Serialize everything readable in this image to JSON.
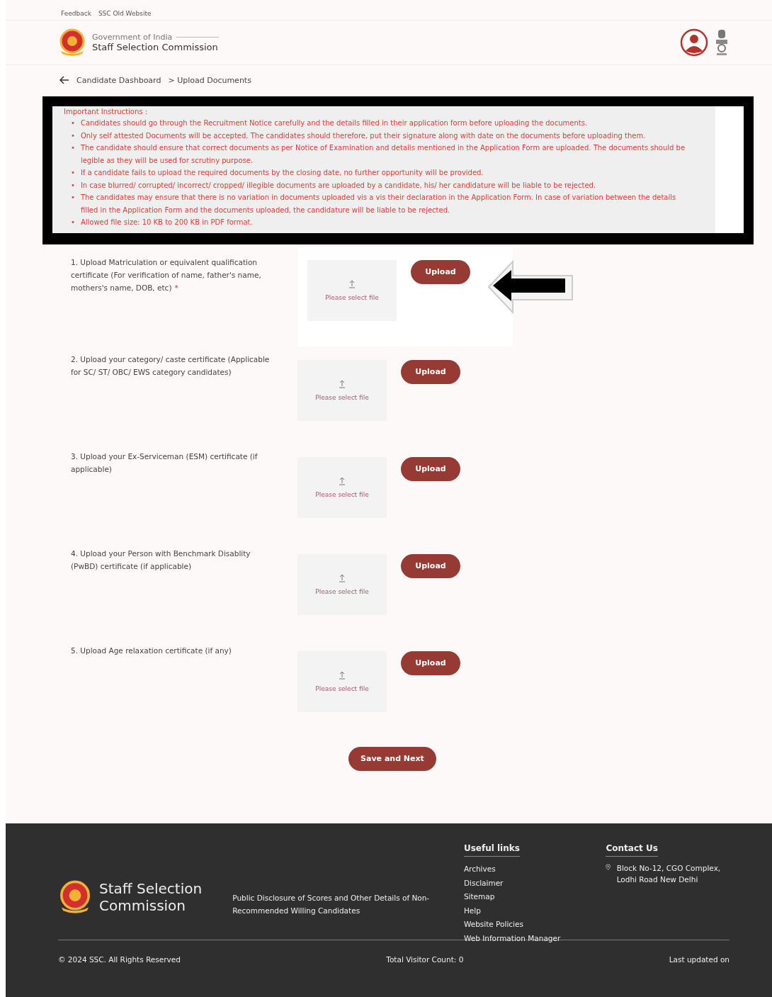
{
  "top_links": [
    "Feedback",
    "SSC Old Website"
  ],
  "header": {
    "org_line": "Government of India",
    "title": "Staff Selection Commission"
  },
  "breadcrumb": [
    {
      "label": "Candidate Dashboard"
    },
    {
      "label": "> Upload Documents"
    }
  ],
  "instructions": {
    "heading": "Important Instructions :",
    "bullet": "•",
    "items": [
      "Candidates should go through the Recruitment Notice carefully and the details filled in their application form before uploading the documents.",
      "Only self attested Documents will be accepted. The candidates should therefore, put their signature along with date on the documents before uploading them.",
      "The candidate should ensure that correct documents as per Notice of Examination and details mentioned in the Application Form are uploaded. The documents should be legible as they will be used for scrutiny purpose.",
      "If a candidate fails to upload the required documents by the closing date, no further opportunity will be provided.",
      "In case blurred/ corrupted/ incorrect/ cropped/ illegible documents are uploaded by a candidate, his/ her candidature will be liable to be rejected.",
      "The candidates may ensure that there is no variation in documents uploaded vis a vis their declaration in the Application Form. In case of variation between the details filled in the Application Form and the documents uploaded, the candidature will be liable to be rejected.",
      "Allowed file size: 10 KB to 200 KB in PDF format."
    ]
  },
  "documents": [
    {
      "label": "1. Upload Matriculation or equivalent qualification certificate (For verification of name, father's name, mothers's name, DOB, etc)",
      "required_mark": "*",
      "placeholder": "Please select file",
      "button": "Upload",
      "highlighted": true
    },
    {
      "label": "2. Upload your category/ caste certificate (Applicable for SC/ ST/ OBC/ EWS category candidates)",
      "placeholder": "Please select file",
      "button": "Upload",
      "highlighted": false
    },
    {
      "label": "3. Upload your Ex-Serviceman (ESM) certificate (if applicable)",
      "placeholder": "Please select file",
      "button": "Upload",
      "highlighted": false
    },
    {
      "label": "4. Upload your Person with Benchmark Disablity (PwBD) certificate (if applicable)",
      "placeholder": "Please select file",
      "button": "Upload",
      "highlighted": false
    },
    {
      "label": "5. Upload Age relaxation certificate (if any)",
      "placeholder": "Please select file",
      "button": "Upload",
      "highlighted": false
    }
  ],
  "save_button": "Save and Next",
  "footer": {
    "brand": "Staff Selection Commission",
    "disclosure_link": "Public Disclosure of Scores and Other Details of Non-Recommended Willing Candidates",
    "useful_links": {
      "heading": "Useful links",
      "items": [
        "Archives",
        "Disclaimer",
        "Sitemap",
        "Help",
        "Website Policies",
        "Web Information Manager"
      ]
    },
    "contact": {
      "heading": "Contact Us",
      "address": "Block No-12, CGO Complex, Lodhi Road New Delhi"
    },
    "copyright": "© 2024 SSC. All Rights Reserved",
    "visitor_count": "Total Visitor Count: 0",
    "last_updated": "Last updated on"
  }
}
